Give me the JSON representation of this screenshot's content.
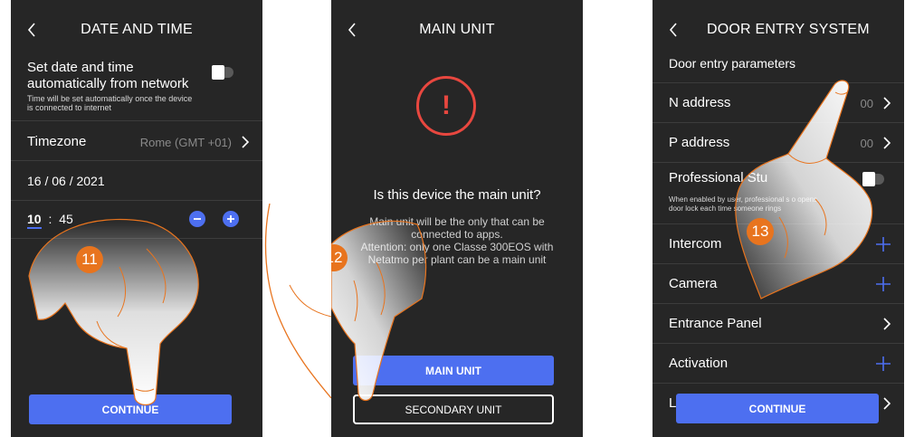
{
  "screen1": {
    "title": "DATE AND TIME",
    "auto_label_line1": "Set date and time",
    "auto_label_line2": "automatically from network",
    "auto_note_line1": "Time will be set automatically once the device",
    "auto_note_line2": "is connected to internet",
    "timezone_label": "Timezone",
    "timezone_value": "Rome (GMT +01)",
    "date_value": "16 / 06 / 2021",
    "time_hour": "10",
    "time_sep": ":",
    "time_minute": "45",
    "continue_label": "CONTINUE",
    "step": "11"
  },
  "screen2": {
    "title": "MAIN UNIT",
    "alert_glyph": "!",
    "question": "Is this device the main unit?",
    "desc_line1": "Main unit will be the only that can be",
    "desc_line2": "connected to apps.",
    "desc_line3": "Attention: only one Classe 300EOS with",
    "desc_line4": "Netatmo per plant can be a main unit",
    "main_button": "MAIN UNIT",
    "secondary_button": "SECONDARY UNIT",
    "step": "12"
  },
  "screen3": {
    "title": "DOOR ENTRY SYSTEM",
    "section": "Door entry parameters",
    "n_label": "N address",
    "n_value": "00",
    "p_label": "P address",
    "p_value": "00",
    "pro_label": "Professional Stu",
    "pro_note_line1": "When enabled by user, professional s        o opens",
    "pro_note_line2": "door lock each time someone rings",
    "intercom": "Intercom",
    "camera": "Camera",
    "entrance": "Entrance Panel",
    "activation": "Activation",
    "last_row_partial": "L",
    "continue_label": "CONTINUE",
    "step": "13"
  },
  "colors": {
    "screen_bg": "#262626",
    "accent_blue": "#4d6ff0",
    "alert_red": "#e8473f",
    "step_orange": "#e8741e",
    "divider": "#3c3c3c"
  },
  "icons": {
    "back": "chevron-left-icon",
    "next": "chevron-right-icon",
    "add": "plus-icon",
    "alert": "exclamation-circle-icon",
    "decrement": "minus-circle-icon",
    "increment": "plus-circle-icon"
  }
}
